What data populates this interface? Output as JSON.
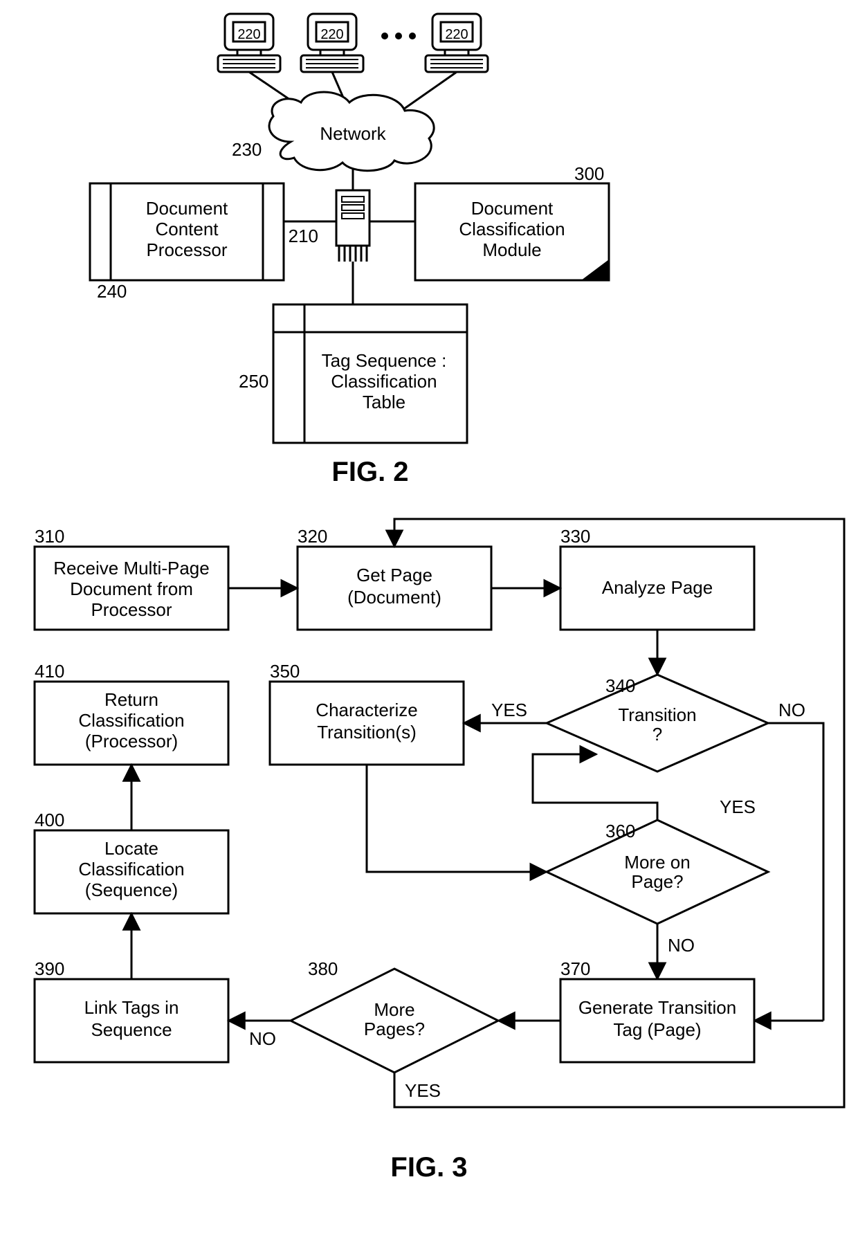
{
  "fig2": {
    "title": "FIG. 2",
    "client_label": "220",
    "network_ref": "230",
    "network_label": "Network",
    "server_ref": "210",
    "processor_ref": "240",
    "processor_lines": [
      "Document",
      "Content",
      "Processor"
    ],
    "module_ref": "300",
    "module_lines": [
      "Document",
      "Classification",
      "Module"
    ],
    "table_ref": "250",
    "table_lines": [
      "Tag Sequence :",
      "Classification",
      "Table"
    ]
  },
  "fig3": {
    "title": "FIG. 3",
    "n310": {
      "ref": "310",
      "lines": [
        "Receive Multi-Page",
        "Document from",
        "Processor"
      ]
    },
    "n320": {
      "ref": "320",
      "lines": [
        "Get Page",
        "(Document)"
      ]
    },
    "n330": {
      "ref": "330",
      "lines": [
        "Analyze Page"
      ]
    },
    "n340": {
      "ref": "340",
      "lines": [
        "Transition",
        "?"
      ]
    },
    "n350": {
      "ref": "350",
      "lines": [
        "Characterize",
        "Transition(s)"
      ]
    },
    "n360": {
      "ref": "360",
      "lines": [
        "More on",
        "Page?"
      ]
    },
    "n370": {
      "ref": "370",
      "lines": [
        "Generate Transition",
        "Tag (Page)"
      ]
    },
    "n380": {
      "ref": "380",
      "lines": [
        "More",
        "Pages?"
      ]
    },
    "n390": {
      "ref": "390",
      "lines": [
        "Link Tags in",
        "Sequence"
      ]
    },
    "n400": {
      "ref": "400",
      "lines": [
        "Locate",
        "Classification",
        "(Sequence)"
      ]
    },
    "n410": {
      "ref": "410",
      "lines": [
        "Return",
        "Classification",
        "(Processor)"
      ]
    },
    "yes": "YES",
    "no": "NO"
  }
}
